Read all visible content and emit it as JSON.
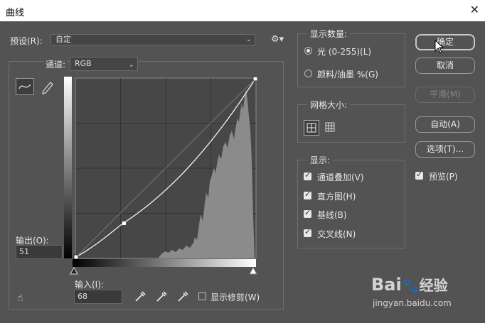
{
  "window": {
    "title": "曲线"
  },
  "preset": {
    "label": "预设(R):",
    "value": "自定"
  },
  "channel": {
    "label": "通道:",
    "value": "RGB"
  },
  "output": {
    "label": "输出(O):",
    "value": "51"
  },
  "input": {
    "label": "输入(I):",
    "value": "68"
  },
  "show_clipping": {
    "label": "显示修剪(W)"
  },
  "display_amount": {
    "title": "显示数量:",
    "light": "光 (0-255)(L)",
    "pigment": "颜料/油墨 %(G)",
    "selected": "light"
  },
  "grid_size": {
    "title": "网格大小:"
  },
  "show": {
    "title": "显示:",
    "items": [
      "通道叠加(V)",
      "直方图(H)",
      "基线(B)",
      "交叉线(N)"
    ]
  },
  "buttons": {
    "ok": "确定",
    "cancel": "取消",
    "smooth": "平滑(M)",
    "auto": "自动(A)",
    "options": "选项(T)..."
  },
  "preview": {
    "label": "预览(P)"
  },
  "watermark": {
    "logo": "Bai",
    "brand": "经验",
    "url": "jingyan.baidu.com"
  }
}
